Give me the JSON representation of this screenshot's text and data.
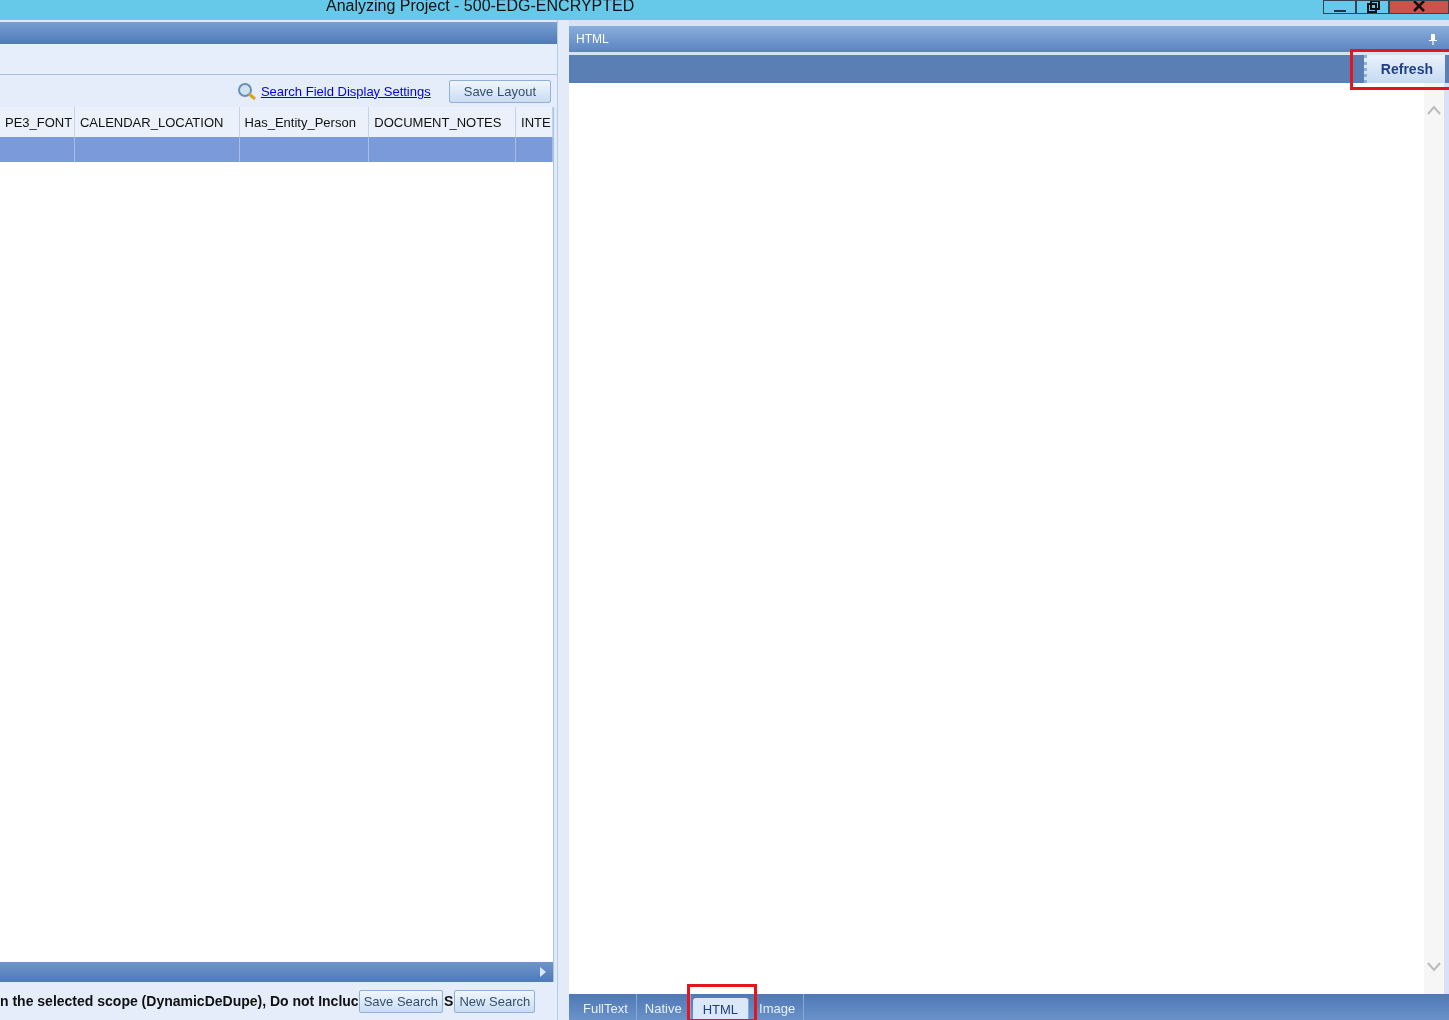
{
  "window": {
    "title": "Analyzing Project - 500-EDG-ENCRYPTED"
  },
  "results": {
    "link": "Search Field Display Settings",
    "save_layout": "Save Layout",
    "columns": [
      "PE3_FONT",
      "CALENDAR_LOCATION",
      "Has_Entity_Person",
      "DOCUMENT_NOTES",
      "INTE"
    ],
    "rows": [
      {
        "selected": true
      }
    ],
    "status": "n the selected scope (DynamicDeDupe), Do not Incluc",
    "status_fragment": "S",
    "buttons": [
      "Save Search",
      "New Search"
    ]
  },
  "viewer": {
    "title": "HTML",
    "refresh": "Refresh",
    "highlighted_refresh": true,
    "tabs": [
      {
        "label": "FullText",
        "selected": false,
        "highlighted": false
      },
      {
        "label": "Native",
        "selected": false,
        "highlighted": false
      },
      {
        "label": "HTML",
        "selected": true,
        "highlighted": true
      },
      {
        "label": "Image",
        "selected": false,
        "highlighted": false
      }
    ]
  }
}
